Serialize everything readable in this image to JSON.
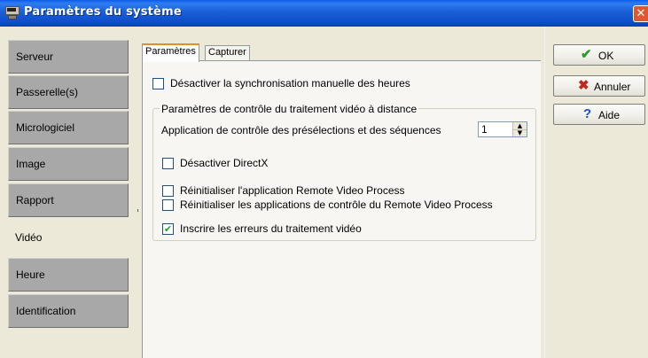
{
  "window": {
    "title": "Paramètres du système",
    "close_glyph": "✕"
  },
  "sidebar": {
    "items": [
      {
        "label": "Serveur",
        "active": false
      },
      {
        "label": "Passerelle(s)",
        "active": false
      },
      {
        "label": "Micrologiciel",
        "active": false
      },
      {
        "label": "Image",
        "active": false
      },
      {
        "label": "Rapport",
        "active": false
      },
      {
        "label": "Vidéo",
        "active": true
      },
      {
        "label": "Heure",
        "active": false
      },
      {
        "label": "Identification",
        "active": false
      }
    ]
  },
  "tabs": [
    {
      "label": "Paramètres",
      "active": true
    },
    {
      "label": "Capturer",
      "active": false
    }
  ],
  "settings": {
    "disable_manual_sync": {
      "label": "Désactiver la synchronisation manuelle des heures",
      "checked": false
    },
    "group_title": "Paramètres de contrôle du traitement vidéo à distance",
    "presets_label": "Application de contrôle des présélections et des séquences",
    "presets_value": "1",
    "disable_directx": {
      "label": "Désactiver DirectX",
      "checked": false
    },
    "reset_app": {
      "label": "Réinitialiser l'application Remote Video Process",
      "checked": false
    },
    "reset_control_apps": {
      "label": "Réinitialiser les applications de contrôle du Remote Video Process",
      "checked": false
    },
    "log_errors": {
      "label": "Inscrire les erreurs du traitement vidéo",
      "checked": true
    }
  },
  "buttons": {
    "ok": {
      "label": "OK",
      "icon": "checkmark-icon",
      "glyph": "✔",
      "color": "#2a9a2a"
    },
    "cancel": {
      "label": "Annuler",
      "icon": "x-icon",
      "glyph": "✖",
      "color": "#c0281e"
    },
    "help": {
      "label": "Aide",
      "icon": "question-icon",
      "glyph": "?",
      "color": "#1a4fd0"
    }
  },
  "colors": {
    "titlebar": "#0a5be8",
    "sidebar_item": "#a8a8a8",
    "active_tab_accent": "#e68b2c"
  }
}
